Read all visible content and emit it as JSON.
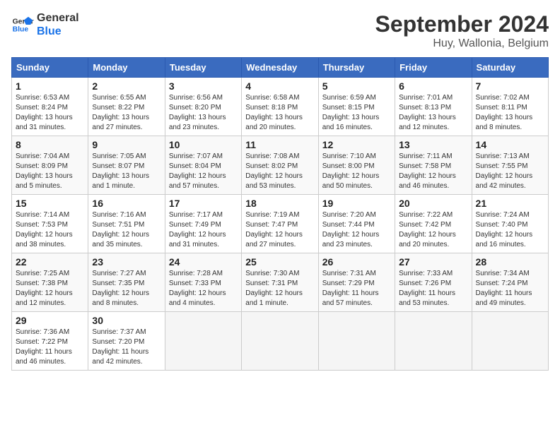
{
  "logo": {
    "line1": "General",
    "line2": "Blue"
  },
  "title": "September 2024",
  "subtitle": "Huy, Wallonia, Belgium",
  "days_of_week": [
    "Sunday",
    "Monday",
    "Tuesday",
    "Wednesday",
    "Thursday",
    "Friday",
    "Saturday"
  ],
  "weeks": [
    [
      {
        "day": "1",
        "detail": "Sunrise: 6:53 AM\nSunset: 8:24 PM\nDaylight: 13 hours\nand 31 minutes."
      },
      {
        "day": "2",
        "detail": "Sunrise: 6:55 AM\nSunset: 8:22 PM\nDaylight: 13 hours\nand 27 minutes."
      },
      {
        "day": "3",
        "detail": "Sunrise: 6:56 AM\nSunset: 8:20 PM\nDaylight: 13 hours\nand 23 minutes."
      },
      {
        "day": "4",
        "detail": "Sunrise: 6:58 AM\nSunset: 8:18 PM\nDaylight: 13 hours\nand 20 minutes."
      },
      {
        "day": "5",
        "detail": "Sunrise: 6:59 AM\nSunset: 8:15 PM\nDaylight: 13 hours\nand 16 minutes."
      },
      {
        "day": "6",
        "detail": "Sunrise: 7:01 AM\nSunset: 8:13 PM\nDaylight: 13 hours\nand 12 minutes."
      },
      {
        "day": "7",
        "detail": "Sunrise: 7:02 AM\nSunset: 8:11 PM\nDaylight: 13 hours\nand 8 minutes."
      }
    ],
    [
      {
        "day": "8",
        "detail": "Sunrise: 7:04 AM\nSunset: 8:09 PM\nDaylight: 13 hours\nand 5 minutes."
      },
      {
        "day": "9",
        "detail": "Sunrise: 7:05 AM\nSunset: 8:07 PM\nDaylight: 13 hours\nand 1 minute."
      },
      {
        "day": "10",
        "detail": "Sunrise: 7:07 AM\nSunset: 8:04 PM\nDaylight: 12 hours\nand 57 minutes."
      },
      {
        "day": "11",
        "detail": "Sunrise: 7:08 AM\nSunset: 8:02 PM\nDaylight: 12 hours\nand 53 minutes."
      },
      {
        "day": "12",
        "detail": "Sunrise: 7:10 AM\nSunset: 8:00 PM\nDaylight: 12 hours\nand 50 minutes."
      },
      {
        "day": "13",
        "detail": "Sunrise: 7:11 AM\nSunset: 7:58 PM\nDaylight: 12 hours\nand 46 minutes."
      },
      {
        "day": "14",
        "detail": "Sunrise: 7:13 AM\nSunset: 7:55 PM\nDaylight: 12 hours\nand 42 minutes."
      }
    ],
    [
      {
        "day": "15",
        "detail": "Sunrise: 7:14 AM\nSunset: 7:53 PM\nDaylight: 12 hours\nand 38 minutes."
      },
      {
        "day": "16",
        "detail": "Sunrise: 7:16 AM\nSunset: 7:51 PM\nDaylight: 12 hours\nand 35 minutes."
      },
      {
        "day": "17",
        "detail": "Sunrise: 7:17 AM\nSunset: 7:49 PM\nDaylight: 12 hours\nand 31 minutes."
      },
      {
        "day": "18",
        "detail": "Sunrise: 7:19 AM\nSunset: 7:47 PM\nDaylight: 12 hours\nand 27 minutes."
      },
      {
        "day": "19",
        "detail": "Sunrise: 7:20 AM\nSunset: 7:44 PM\nDaylight: 12 hours\nand 23 minutes."
      },
      {
        "day": "20",
        "detail": "Sunrise: 7:22 AM\nSunset: 7:42 PM\nDaylight: 12 hours\nand 20 minutes."
      },
      {
        "day": "21",
        "detail": "Sunrise: 7:24 AM\nSunset: 7:40 PM\nDaylight: 12 hours\nand 16 minutes."
      }
    ],
    [
      {
        "day": "22",
        "detail": "Sunrise: 7:25 AM\nSunset: 7:38 PM\nDaylight: 12 hours\nand 12 minutes."
      },
      {
        "day": "23",
        "detail": "Sunrise: 7:27 AM\nSunset: 7:35 PM\nDaylight: 12 hours\nand 8 minutes."
      },
      {
        "day": "24",
        "detail": "Sunrise: 7:28 AM\nSunset: 7:33 PM\nDaylight: 12 hours\nand 4 minutes."
      },
      {
        "day": "25",
        "detail": "Sunrise: 7:30 AM\nSunset: 7:31 PM\nDaylight: 12 hours\nand 1 minute."
      },
      {
        "day": "26",
        "detail": "Sunrise: 7:31 AM\nSunset: 7:29 PM\nDaylight: 11 hours\nand 57 minutes."
      },
      {
        "day": "27",
        "detail": "Sunrise: 7:33 AM\nSunset: 7:26 PM\nDaylight: 11 hours\nand 53 minutes."
      },
      {
        "day": "28",
        "detail": "Sunrise: 7:34 AM\nSunset: 7:24 PM\nDaylight: 11 hours\nand 49 minutes."
      }
    ],
    [
      {
        "day": "29",
        "detail": "Sunrise: 7:36 AM\nSunset: 7:22 PM\nDaylight: 11 hours\nand 46 minutes."
      },
      {
        "day": "30",
        "detail": "Sunrise: 7:37 AM\nSunset: 7:20 PM\nDaylight: 11 hours\nand 42 minutes."
      },
      {
        "day": "",
        "detail": ""
      },
      {
        "day": "",
        "detail": ""
      },
      {
        "day": "",
        "detail": ""
      },
      {
        "day": "",
        "detail": ""
      },
      {
        "day": "",
        "detail": ""
      }
    ]
  ]
}
